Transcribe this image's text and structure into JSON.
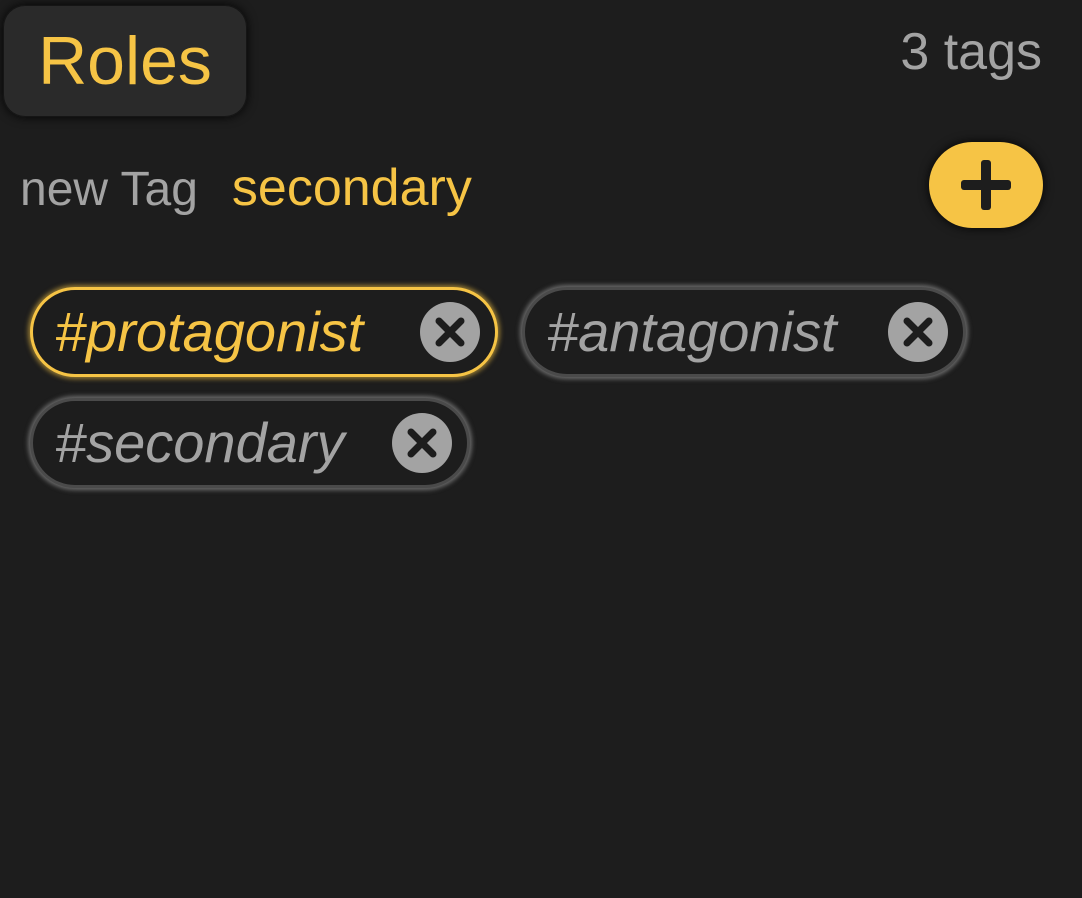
{
  "header": {
    "title": "Roles",
    "tag_count": "3 tags"
  },
  "new_tag": {
    "label": "new Tag",
    "value": "secondary"
  },
  "add_button": {
    "icon": "plus-icon"
  },
  "tags": [
    {
      "label": "#protagonist",
      "selected": true,
      "remove_icon": "close-circle-icon"
    },
    {
      "label": "#antagonist",
      "selected": false,
      "remove_icon": "close-circle-icon"
    },
    {
      "label": "#secondary",
      "selected": false,
      "remove_icon": "close-circle-icon"
    }
  ],
  "colors": {
    "background": "#1d1d1d",
    "accent": "#f6c445",
    "muted_text": "#a3a3a3"
  }
}
